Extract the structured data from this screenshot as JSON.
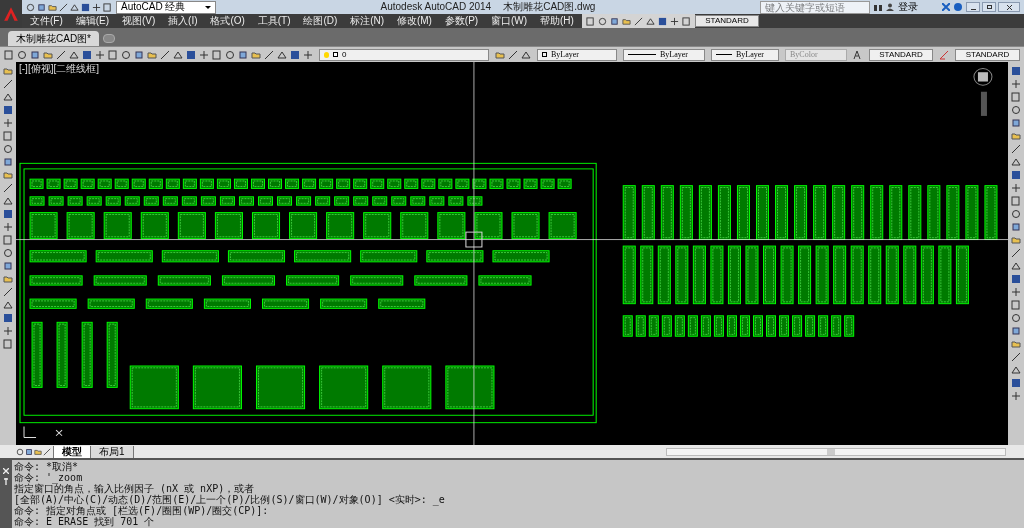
{
  "title_bar": {
    "workspace": "AutoCAD 经典",
    "app_title": "Autodesk AutoCAD 2014",
    "file_title": "木制雕花CAD图.dwg",
    "search": {
      "placeholder": "键入关键字或短语"
    },
    "sign_in": "登录"
  },
  "menu": [
    "文件(F)",
    "编辑(E)",
    "视图(V)",
    "插入(I)",
    "格式(O)",
    "工具(T)",
    "绘图(D)",
    "标注(N)",
    "修改(M)",
    "参数(P)",
    "窗口(W)",
    "帮助(H)"
  ],
  "dim_style": "STANDARD",
  "doc_tabs": [
    {
      "label": "木制雕花CAD图*",
      "selected": true
    }
  ],
  "layer": "0",
  "properties": {
    "object_colour_setting": "ByLayer",
    "linetype": "ByLayer",
    "lineweight": "ByLayer",
    "plot_style": "ByColor",
    "text_style": "STANDARD",
    "table_style": "STANDARD"
  },
  "viewport_label": "[-][俯视][二维线框]",
  "layout_tabs": [
    {
      "label": "模型",
      "selected": true
    },
    {
      "label": "布局1",
      "selected": false
    }
  ],
  "command_history": [
    "命令: *取消*",
    "命令: '_zoom",
    "指定窗口的角点，输入比例因子 (nX 或 nXP)，或者",
    "[全部(A)/中心(C)/动态(D)/范围(E)/上一个(P)/比例(S)/窗口(W)/对象(O)] <实时>: _e",
    "命令: 指定对角点或 [栏选(F)/圈围(WP)/圈交(CP)]:",
    "命令: E ERASE 找到 701 个"
  ]
}
